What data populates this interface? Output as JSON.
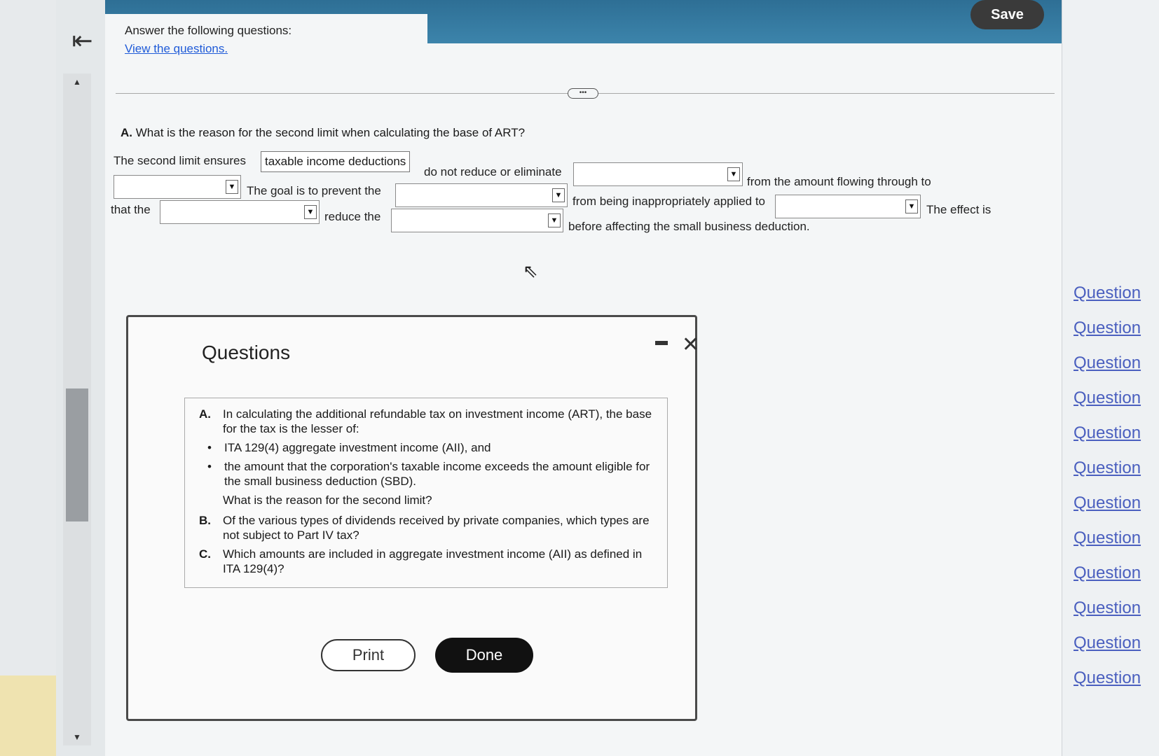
{
  "header": {
    "instruction": "Answer the following questions:",
    "view_link": "View the questions.",
    "save_label": "Save"
  },
  "question_a": {
    "letter": "A.",
    "title": "What is the reason for the second limit when calculating the base of ART?",
    "seg1": "The second limit ensures",
    "answer_box": "taxable income deductions",
    "seg2": "do not reduce or eliminate",
    "seg3": "from the amount flowing through to",
    "seg4": "The goal is to prevent the",
    "seg5": "from being inappropriately applied to",
    "seg6": "The effect is",
    "seg7": "that the",
    "seg8": "reduce the",
    "seg9": "before affecting the small business deduction."
  },
  "modal": {
    "title": "Questions",
    "items": [
      {
        "letter": "A.",
        "text": "In calculating the additional refundable tax on investment income (ART), the base for the tax is the lesser of:",
        "bullets": [
          "ITA 129(4) aggregate investment income (AII), and",
          "the amount that the corporation's taxable income exceeds the amount eligible for the small business deduction (SBD)."
        ],
        "followup": "What is the reason for the second limit?"
      },
      {
        "letter": "B.",
        "text": "Of the various types of dividends received by private companies, which types are not subject to Part IV tax?"
      },
      {
        "letter": "C.",
        "text": "Which amounts are included in aggregate investment income (AII) as defined in ITA 129(4)?"
      }
    ],
    "print_label": "Print",
    "done_label": "Done"
  },
  "sidebar": {
    "links": [
      "Question",
      "Question",
      "Question",
      "Question",
      "Question",
      "Question",
      "Question",
      "Question",
      "Question",
      "Question",
      "Question",
      "Question"
    ]
  },
  "icons": {
    "collapse": "collapse-left-icon",
    "close": "close-icon",
    "minimize": "minimize-icon",
    "dropdown": "triangle-down-icon"
  },
  "colors": {
    "topbar": "#2e6f95",
    "link": "#1f5bd8",
    "done_button": "#111111",
    "save_button": "#3a3a3a"
  }
}
